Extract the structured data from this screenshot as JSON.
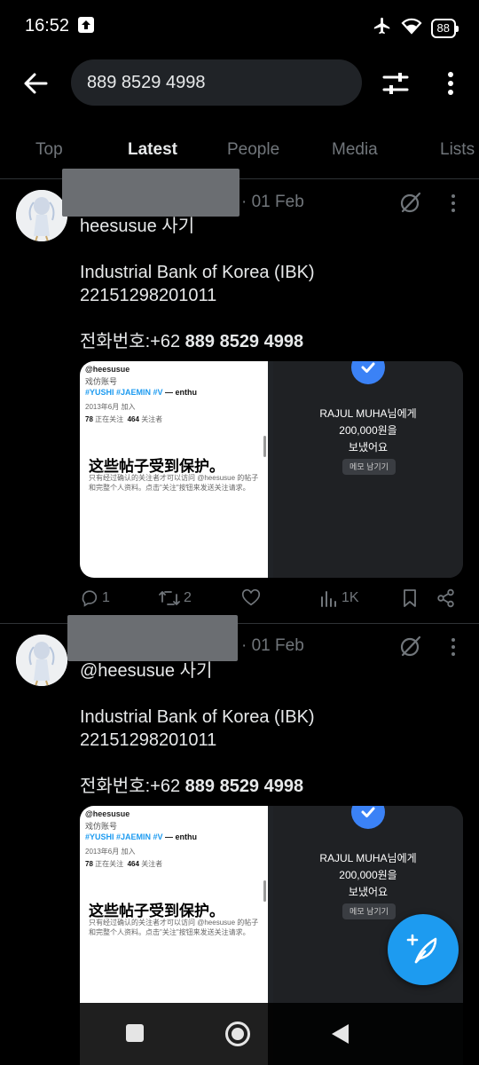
{
  "status_bar": {
    "time": "16:52",
    "battery": "88"
  },
  "search": {
    "query": "889 8529 4998"
  },
  "tabs": [
    {
      "label": "Top",
      "active": false
    },
    {
      "label": "Latest",
      "active": true
    },
    {
      "label": "People",
      "active": false
    },
    {
      "label": "Media",
      "active": false
    },
    {
      "label": "Lists",
      "active": false
    }
  ],
  "tweets": [
    {
      "date": "· 01 Feb",
      "line1": "heesusue  사기",
      "line2": "Industrial Bank of Korea (IBK)",
      "line3": "22151298201011",
      "phone_prefix": "전화번호:+62 ",
      "phone_bold": "889 8529 4998",
      "media": {
        "handle": "@heesusue",
        "sub": "戏仿账号",
        "tags": "#YUSHI #JAEMIN #V",
        "tags_suffix": " — enthu",
        "joined": "2013年6月 加入",
        "following_count": "78",
        "following_label": "正在关注",
        "followers_count": "464",
        "followers_label": "关注者",
        "protected_title": "这些帖子受到保护。",
        "protected_desc": "只有经过确认的关注者才可以访问 @heesusue 的帖子和完整个人资料。点击\"关注\"按钮来发送关注请求。",
        "payment_line1": "RAJUL MUHA님에게",
        "payment_line2": "200,000원을",
        "payment_line3": "보냈어요",
        "memo_button": "메모 남기기"
      },
      "replies": "1",
      "reposts": "2",
      "likes": "",
      "views": "1K"
    },
    {
      "date": "· 01 Feb",
      "line1": "@heesusue 사기",
      "line2": "Industrial Bank of Korea (IBK)",
      "line3": "22151298201011",
      "phone_prefix": "전화번호:+62 ",
      "phone_bold": "889 8529 4998",
      "media": {
        "handle": "@heesusue",
        "sub": "戏仿账号",
        "tags": "#YUSHI #JAEMIN #V",
        "tags_suffix": " — enthu",
        "joined": "2013年6月 加入",
        "following_count": "78",
        "following_label": "正在关注",
        "followers_count": "464",
        "followers_label": "关注者",
        "protected_title": "这些帖子受到保护。",
        "protected_desc": "只有经过确认的关注者才可以访问 @heesusue 的帖子和完整个人资料。点击\"关注\"按钮来发送关注请求。",
        "payment_line1": "RAJUL MUHA님에게",
        "payment_line2": "200,000원을",
        "payment_line3": "보냈어요",
        "memo_button": "메모 남기기"
      }
    }
  ],
  "icons": {
    "back": "arrow-left-icon",
    "filter": "sliders-icon",
    "more": "vertical-dots-icon",
    "grok": "grok-icon",
    "reply": "comment-icon",
    "repost": "repost-icon",
    "like": "heart-icon",
    "views": "bar-chart-icon",
    "bookmark": "bookmark-icon",
    "share": "share-icon",
    "compose": "feather-plus-icon"
  },
  "colors": {
    "accent": "#1d9bf0",
    "background": "#000000",
    "muted": "#71767b",
    "text": "#e7e9ea"
  }
}
